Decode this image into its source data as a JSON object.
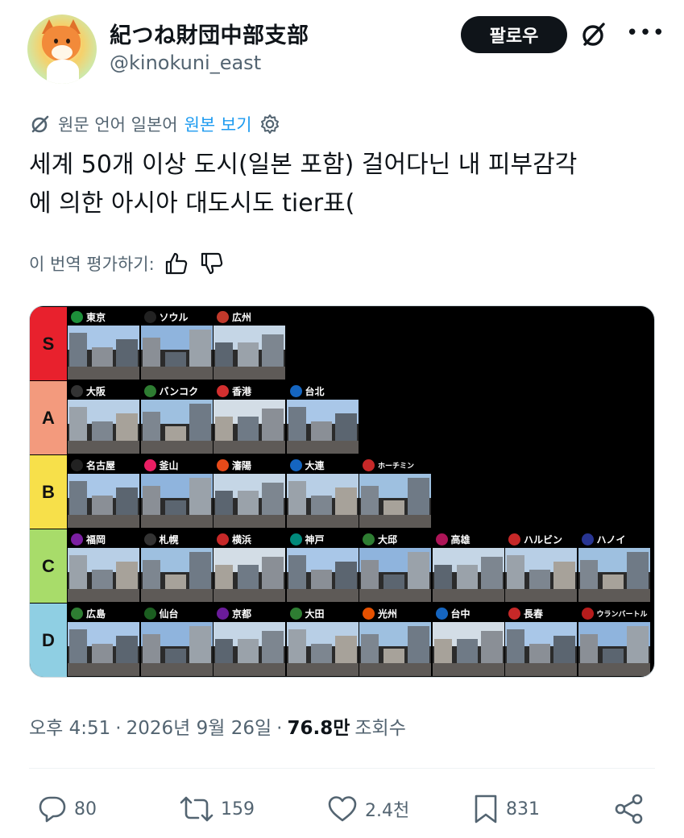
{
  "author": {
    "display_name": "紀つね財団中部支部",
    "handle": "@kinokuni_east",
    "follow_label": "팔로우"
  },
  "translation": {
    "source_label": "원문 언어 일본어",
    "view_original": "원본 보기"
  },
  "tweet": {
    "line1": "세계 50개 이상 도시(일본 포함) 걸어다닌 내 피부감각",
    "line2": "에 의한 아시아 대도시도 tier표("
  },
  "rate": {
    "label": "이 번역 평가하기:"
  },
  "tier_list": {
    "tiers": [
      {
        "label": "S",
        "color": "#e8212d",
        "cities": [
          {
            "name": "東京",
            "color": "#1d8f3a"
          },
          {
            "name": "ソウル",
            "color": "#222222"
          },
          {
            "name": "広州",
            "color": "#c0392b"
          }
        ]
      },
      {
        "label": "A",
        "color": "#f39a7d",
        "cities": [
          {
            "name": "大阪",
            "color": "#333333"
          },
          {
            "name": "バンコク",
            "color": "#2e7d32"
          },
          {
            "name": "香港",
            "color": "#d32f2f"
          },
          {
            "name": "台北",
            "color": "#1565c0"
          }
        ]
      },
      {
        "label": "B",
        "color": "#f7e04a",
        "cities": [
          {
            "name": "名古屋",
            "color": "#222222"
          },
          {
            "name": "釜山",
            "color": "#e91e63"
          },
          {
            "name": "瀋陽",
            "color": "#e64a19"
          },
          {
            "name": "大連",
            "color": "#1565c0"
          },
          {
            "name": "ホーチミン",
            "color": "#c62828"
          }
        ]
      },
      {
        "label": "C",
        "color": "#a8dc6a",
        "cities": [
          {
            "name": "福岡",
            "color": "#7b1fa2"
          },
          {
            "name": "札幌",
            "color": "#333333"
          },
          {
            "name": "横浜",
            "color": "#c62828"
          },
          {
            "name": "神戸",
            "color": "#00897b"
          },
          {
            "name": "大邱",
            "color": "#2e7d32"
          },
          {
            "name": "高雄",
            "color": "#ad1457"
          },
          {
            "name": "ハルビン",
            "color": "#c62828"
          },
          {
            "name": "ハノイ",
            "color": "#283593"
          }
        ]
      },
      {
        "label": "D",
        "color": "#8fcfe3",
        "cities": [
          {
            "name": "広島",
            "color": "#2e7d32"
          },
          {
            "name": "仙台",
            "color": "#1b5e20"
          },
          {
            "name": "京都",
            "color": "#6a1b9a"
          },
          {
            "name": "大田",
            "color": "#2e7d32"
          },
          {
            "name": "光州",
            "color": "#e65100"
          },
          {
            "name": "台中",
            "color": "#1565c0"
          },
          {
            "name": "長春",
            "color": "#c62828"
          },
          {
            "name": "ウランバートル",
            "color": "#b71c1c"
          }
        ]
      }
    ]
  },
  "meta": {
    "time": "오후 4:51",
    "sep1": "·",
    "date": "2026년 9월 26일",
    "sep2": "·",
    "views": "76.8만",
    "views_label": "조회수"
  },
  "actions": {
    "replies": "80",
    "reposts": "159",
    "likes": "2.4천",
    "bookmarks": "831"
  },
  "colors": {
    "link": "#1d9bf0",
    "text": "#0f1419",
    "muted": "#536471",
    "follow_bg": "#0f1419"
  }
}
